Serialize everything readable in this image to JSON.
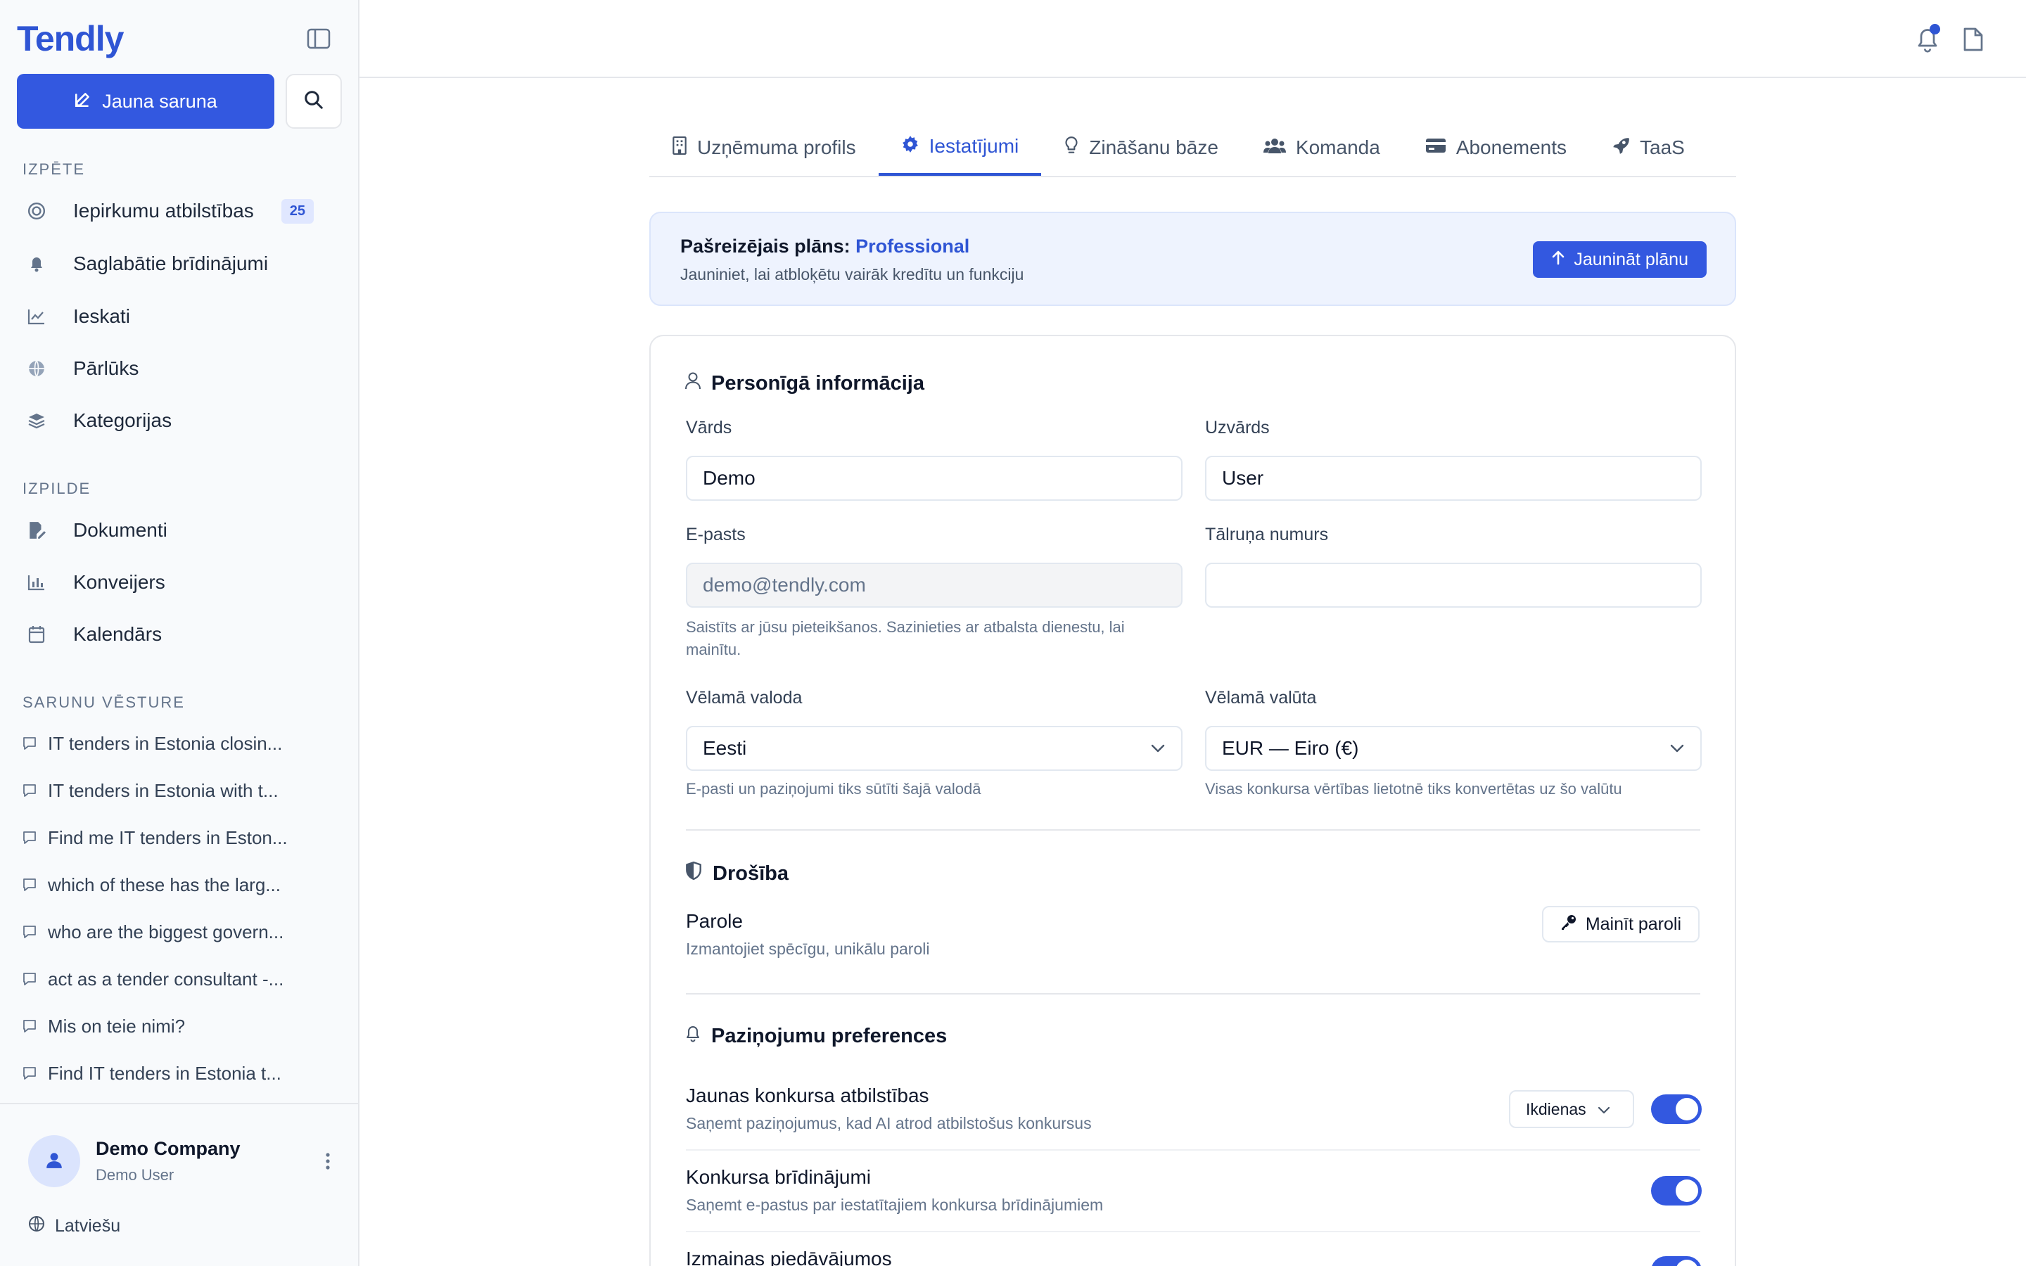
{
  "sidebar": {
    "logo": "Tendly",
    "new_chat_label": "Jauna saruna",
    "sections": {
      "explore": "Izpēte",
      "execution": "Izpilde",
      "history": "Sarunu vēsture"
    },
    "explore_items": [
      {
        "label": "Iepirkumu atbilstības",
        "icon": "target-icon",
        "badge": "25"
      },
      {
        "label": "Saglabātie brīdinājumi",
        "icon": "bell-icon"
      },
      {
        "label": "Ieskati",
        "icon": "chart-line-icon"
      },
      {
        "label": "Pārlūks",
        "icon": "globe-icon"
      },
      {
        "label": "Kategorijas",
        "icon": "layers-icon"
      }
    ],
    "execution_items": [
      {
        "label": "Dokumenti",
        "icon": "document-edit-icon"
      },
      {
        "label": "Konveijers",
        "icon": "bar-chart-icon"
      },
      {
        "label": "Kalendārs",
        "icon": "calendar-icon"
      }
    ],
    "history_items": [
      "IT tenders in Estonia closin...",
      "IT tenders in Estonia with t...",
      "Find me IT tenders in Eston...",
      "which of these has the larg...",
      "who are the biggest govern...",
      "act as a tender consultant -...",
      "Mis on teie nimi?",
      "Find IT tenders in Estonia t..."
    ],
    "account": {
      "company": "Demo Company",
      "user": "Demo User"
    },
    "language": "Latviešu"
  },
  "tabs": [
    {
      "label": "Uzņēmuma profils",
      "icon": "building-icon"
    },
    {
      "label": "Iestatījumi",
      "icon": "gear-icon",
      "active": true
    },
    {
      "label": "Zināšanu bāze",
      "icon": "lightbulb-icon"
    },
    {
      "label": "Komanda",
      "icon": "users-icon"
    },
    {
      "label": "Abonements",
      "icon": "credit-card-icon"
    },
    {
      "label": "TaaS",
      "icon": "rocket-icon"
    }
  ],
  "plan": {
    "prefix": "Pašreizējais plāns:",
    "name": "Professional",
    "subtitle": "Jauniniet, lai atbloķētu vairāk kredītu un funkciju",
    "upgrade_label": "Jaunināt plānu"
  },
  "personal": {
    "title": "Personīgā informācija",
    "first_name_label": "Vārds",
    "first_name_value": "Demo",
    "last_name_label": "Uzvārds",
    "last_name_value": "User",
    "email_label": "E-pasts",
    "email_value": "demo@tendly.com",
    "email_hint": "Saistīts ar jūsu pieteikšanos. Sazinieties ar atbalsta dienestu, lai mainītu.",
    "phone_label": "Tālruņa numurs",
    "phone_value": "",
    "language_label": "Vēlamā valoda",
    "language_value": "Eesti",
    "language_hint": "E-pasti un paziņojumi tiks sūtīti šajā valodā",
    "currency_label": "Vēlamā valūta",
    "currency_value": "EUR — Eiro (€)",
    "currency_hint": "Visas konkursa vērtības lietotnē tiks konvertētas uz šo valūtu"
  },
  "security": {
    "title": "Drošība",
    "password_label": "Parole",
    "password_hint": "Izmantojiet spēcīgu, unikālu paroli",
    "change_password_label": "Mainīt paroli"
  },
  "notifications": {
    "title": "Paziņojumu preferences",
    "rows": [
      {
        "title": "Jaunas konkursa atbilstības",
        "subtitle": "Saņemt paziņojumus, kad AI atrod atbilstošus konkursus",
        "frequency": "Ikdienas",
        "enabled": true
      },
      {
        "title": "Konkursa brīdinājumi",
        "subtitle": "Saņemt e-pastus par iestatītajiem konkursa brīdinājumiem",
        "enabled": true
      },
      {
        "title": "Izmaiņas piedāvājumos",
        "subtitle": "",
        "enabled": true
      }
    ]
  },
  "colors": {
    "accent": "#3358e0",
    "accent_text": "#2f55d4",
    "plan_bg": "#eef3fe"
  }
}
